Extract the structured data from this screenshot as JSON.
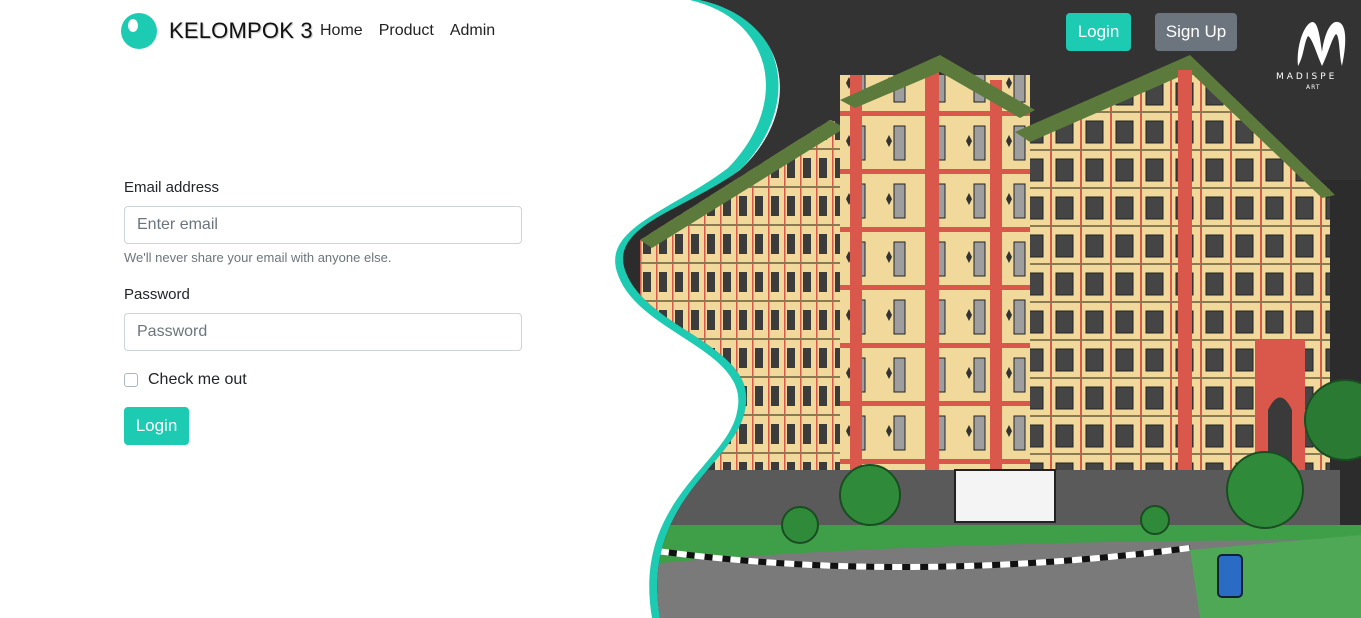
{
  "brand": {
    "name": "KELOMPOK 3"
  },
  "nav": {
    "links": [
      "Home",
      "Product",
      "Admin"
    ],
    "login_label": "Login",
    "signup_label": "Sign Up"
  },
  "watermark": {
    "text": "MADISPE",
    "sub": "ART"
  },
  "form": {
    "email_label": "Email address",
    "email_placeholder": "Enter email",
    "email_hint": "We'll never share your email with anyone else.",
    "password_label": "Password",
    "password_placeholder": "Password",
    "checkbox_label": "Check me out",
    "submit_label": "Login"
  },
  "colors": {
    "accent": "#1ccbb1",
    "secondary": "#6c757d",
    "sky": "#2c2c2c",
    "building_red": "#d9584b",
    "building_cream": "#f0d99a"
  }
}
